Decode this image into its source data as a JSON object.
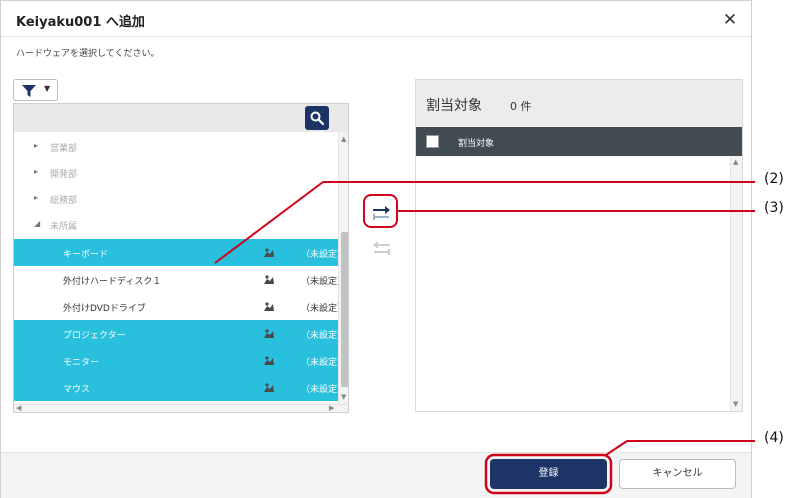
{
  "dialog": {
    "title": "Keiyaku001 へ追加",
    "close_label": "✕",
    "instruction": "ハードウェアを選択してください。"
  },
  "filter": {
    "icon": "filter-icon",
    "caret": "▼"
  },
  "search": {
    "icon": "search-icon"
  },
  "tree": {
    "groups": [
      {
        "caret": "▸",
        "label": "営業部"
      },
      {
        "caret": "▸",
        "label": "開発部"
      },
      {
        "caret": "▸",
        "label": "総務部"
      },
      {
        "caret": "◢",
        "label": "未所属"
      }
    ],
    "items": [
      {
        "label": "キーボード",
        "status": "（未設定）",
        "selected": true
      },
      {
        "label": "外付けハードディスク１",
        "status": "（未設定）",
        "selected": false
      },
      {
        "label": "外付けDVDドライブ",
        "status": "（未設定）",
        "selected": false
      },
      {
        "label": "プロジェクター",
        "status": "（未設定）",
        "selected": true
      },
      {
        "label": "モニター",
        "status": "（未設定）",
        "selected": true
      },
      {
        "label": "マウス",
        "status": "（未設定）",
        "selected": true
      }
    ]
  },
  "scroll": {
    "up": "▲",
    "down": "▼",
    "left": "◀",
    "right": "▶"
  },
  "right_panel": {
    "title": "割当対象",
    "count": "0 件",
    "column_header": "割当対象"
  },
  "buttons": {
    "register": "登録",
    "cancel": "キャンセル"
  },
  "annotations": [
    "(2)",
    "(3)",
    "(4)"
  ],
  "colors": {
    "selection": "#29c0de",
    "primary": "#1e3467",
    "table_header": "#414b52",
    "annotation": "#d0021b"
  }
}
